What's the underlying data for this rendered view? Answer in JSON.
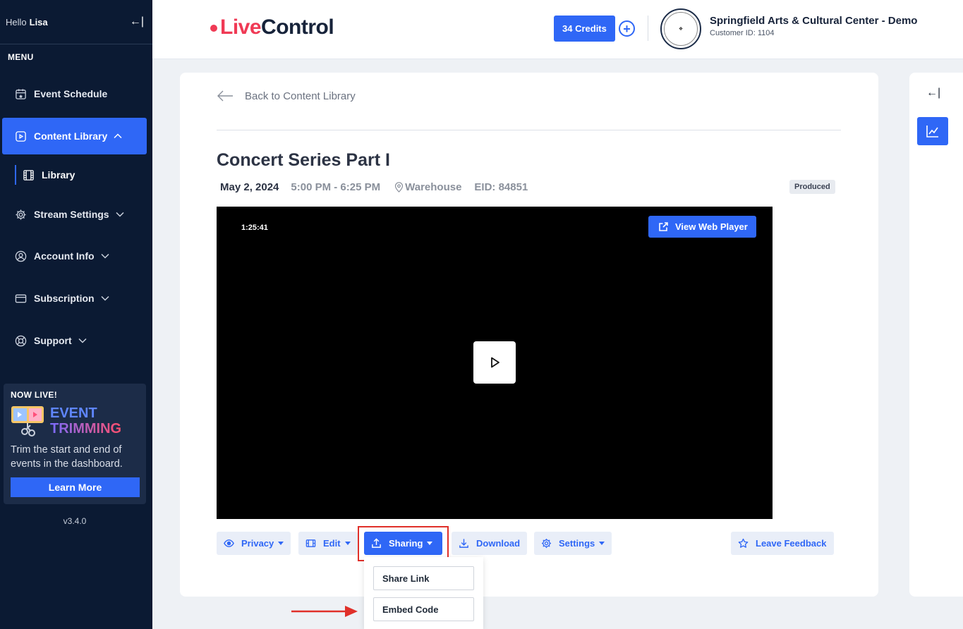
{
  "sidebar": {
    "greeting": "Hello",
    "user": "Lisa",
    "menu_heading": "MENU",
    "items": [
      {
        "label": "Event Schedule",
        "icon": "calendar-star-icon"
      },
      {
        "label": "Content Library",
        "icon": "play-square-icon",
        "active": true
      },
      {
        "label": "Stream Settings",
        "icon": "gear-icon"
      },
      {
        "label": "Account Info",
        "icon": "user-circle-icon"
      },
      {
        "label": "Subscription",
        "icon": "credit-card-icon"
      },
      {
        "label": "Support",
        "icon": "lifebuoy-icon"
      }
    ],
    "sub_item": {
      "label": "Library",
      "icon": "film-icon"
    },
    "promo": {
      "heading": "NOW LIVE!",
      "title_line1": "EVENT",
      "title_line2": "TRIMMING",
      "text": "Trim the start and end of events in the dashboard.",
      "button": "Learn More"
    },
    "version": "v3.4.0"
  },
  "header": {
    "logo_live": "Live",
    "logo_control": "Control",
    "credits": "34 Credits",
    "org_name": "Springfield Arts & Cultural Center - Demo",
    "customer_id": "Customer ID: 1104"
  },
  "content": {
    "back_label": "Back to Content Library",
    "title": "Concert Series Part I",
    "date": "May 2, 2024",
    "time": "5:00 PM - 6:25 PM",
    "location": "Warehouse",
    "eid": "EID: 84851",
    "status": "Produced",
    "duration": "1:25:41",
    "web_player": "View Web Player",
    "actions": {
      "privacy": "Privacy",
      "edit": "Edit",
      "sharing": "Sharing",
      "download": "Download",
      "settings": "Settings",
      "feedback": "Leave Feedback"
    },
    "sharing_menu": [
      "Share Link",
      "Embed Code"
    ]
  },
  "colors": {
    "primary": "#2f67f6",
    "sidebar_bg": "#0b1a33",
    "brand_red": "#f03a55",
    "highlight": "#e0302a"
  }
}
